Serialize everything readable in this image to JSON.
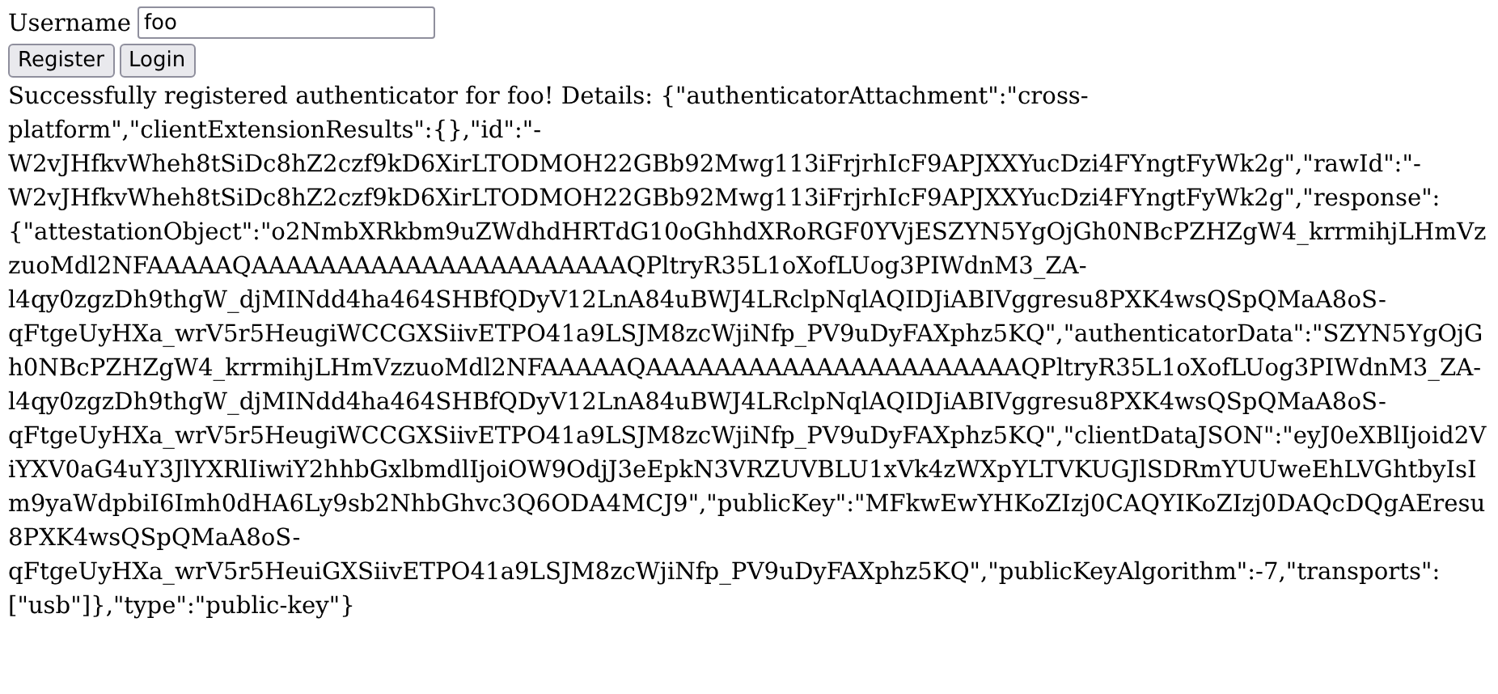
{
  "username": {
    "label": "Username",
    "value": "foo"
  },
  "buttons": [
    "Register",
    "Login"
  ],
  "message": "Successfully registered authenticator for foo! Details: {\"authenticatorAttachment\":\"cross-platform\",\"clientExtensionResults\":{},\"id\":\"-W2vJHfkvWheh8tSiDc8hZ2czf9kD6XirLTODMOH22GBb92Mwg113iFrjrhIcF9APJXXYucDzi4FYngtFyWk2g\",\"rawId\":\"-W2vJHfkvWheh8tSiDc8hZ2czf9kD6XirLTODMOH22GBb92Mwg113iFrjrhIcF9APJXXYucDzi4FYngtFyWk2g\",\"response\":{\"attestationObject\":\"o2NmbXRkbm9uZWdhdHRTdG10oGhhdXRoRGF0YVjESZYN5YgOjGh0NBcPZHZgW4_krrmihjLHmVzzuoMdl2NFAAAAAQAAAAAAAAAAAAAAAAAAAAAAQPltryR35L1oXofLUog3PIWdnM3_ZA-l4qy0zgzDh9thgW_djMINdd4ha464SHBfQDyV12LnA84uBWJ4LRclpNqlAQIDJiABIVggresu8PXK4wsQSpQMaA8oS-qFtgeUyHXa_wrV5r5HeugiWCCGXSiivETPO41a9LSJM8zcWjiNfp_PV9uDyFAXphz5KQ\",\"authenticatorData\":\"SZYN5YgOjGh0NBcPZHZgW4_krrmihjLHmVzzuoMdl2NFAAAAAQAAAAAAAAAAAAAAAAAAAAAAQPltryR35L1oXofLUog3PIWdnM3_ZA-l4qy0zgzDh9thgW_djMINdd4ha464SHBfQDyV12LnA84uBWJ4LRclpNqlAQIDJiABIVggresu8PXK4wsQSpQMaA8oS-qFtgeUyHXa_wrV5r5HeugiWCCGXSiivETPO41a9LSJM8zcWjiNfp_PV9uDyFAXphz5KQ\",\"clientDataJSON\":\"eyJ0eXBlIjoid2ViYXV0aG4uY3JlYXRlIiwiY2hhbGxlbmdlIjoiOW9OdjJ3eEpkN3VRZUVBLU1xVk4zWXpYLTVKUGJlSDRmYUUweEhLVGhtbyIsIm9yaWdpbiI6Imh0dHA6Ly9sb2NhbGhvc3Q6ODA4MCJ9\",\"publicKey\":\"MFkwEwYHKoZIzj0CAQYIKoZIzj0DAQcDQgAEresu8PXK4wsQSpQMaA8oS-qFtgeUyHXa_wrV5r5HeuiGXSiivETPO41a9LSJM8zcWjiNfp_PV9uDyFAXphz5KQ\",\"publicKeyAlgorithm\":-7,\"transports\":[\"usb\"]},\"type\":\"public-key\"}"
}
